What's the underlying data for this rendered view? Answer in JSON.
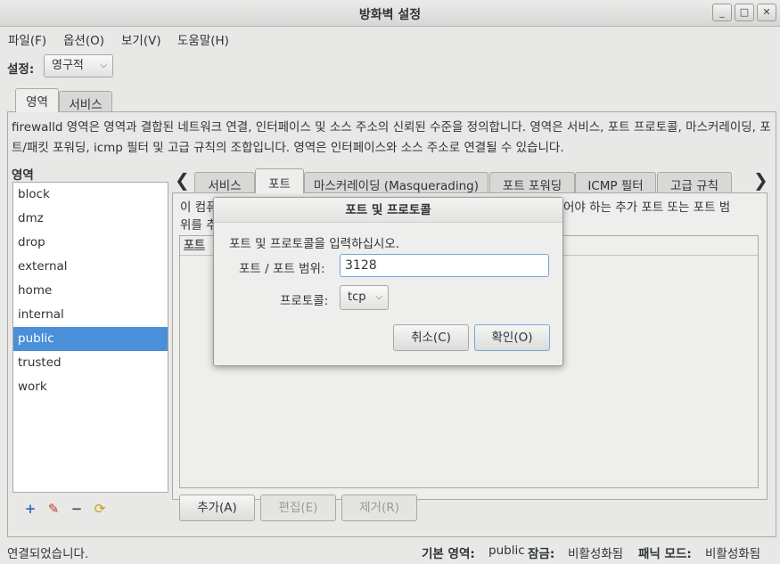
{
  "window": {
    "title": "방화벽 설정",
    "controls": [
      "_",
      "□",
      "✕"
    ]
  },
  "menu": [
    "파일(F)",
    "옵션(O)",
    "보기(V)",
    "도움말(H)"
  ],
  "config": {
    "label": "설정:",
    "value": "영구적"
  },
  "main_tabs": [
    "영역",
    "서비스"
  ],
  "description": "firewalld 영역은 영역과 결합된 네트워크 연결, 인터페이스 및 소스 주소의 신뢰된 수준을 정의합니다. 영역은 서비스, 포트 프로토콜, 마스커레이딩, 포트/패킷 포워딩, icmp 필터 및 고급 규칙의 조합입니다. 영역은 인터페이스와 소스 주소로 연결될 수 있습니다.",
  "zones": {
    "label": "영역",
    "items": [
      "block",
      "dmz",
      "drop",
      "external",
      "home",
      "internal",
      "public",
      "trusted",
      "work"
    ],
    "selected": "public"
  },
  "sub_tabs": [
    "서비스",
    "포트",
    "마스커레이딩 (Masquerading)",
    "포트 포워딩",
    "ICMP 필터",
    "고급 규칙"
  ],
  "ports_panel": {
    "intro_left": "이 컴퓨",
    "intro_left2": "위를 추",
    "intro_right": "어야 하는 추가 포트 또는 포트 범",
    "column": "포트"
  },
  "bottom_buttons": {
    "add": "추가(A)",
    "edit": "편집(E)",
    "remove": "제거(R)"
  },
  "status": {
    "connection": "연결되었습니다.",
    "default_zone_label": "기본 영역:",
    "default_zone_value": "public",
    "lockdown_label": "잠금:",
    "lockdown_value": "비활성화됨",
    "panic_label": "패닉 모드:",
    "panic_value": "비활성화됨"
  },
  "dialog": {
    "title": "포트 및 프로토콜",
    "prompt": "포트 및 프로토콜을 입력하십시오.",
    "port_label": "포트 / 포트 범위:",
    "port_value": "3128",
    "protocol_label": "프로토콜:",
    "protocol_value": "tcp",
    "cancel": "취소(C)",
    "ok": "확인(O)"
  },
  "colors": {
    "selection": "#4a90d9",
    "focus": "#7aa5d6"
  }
}
